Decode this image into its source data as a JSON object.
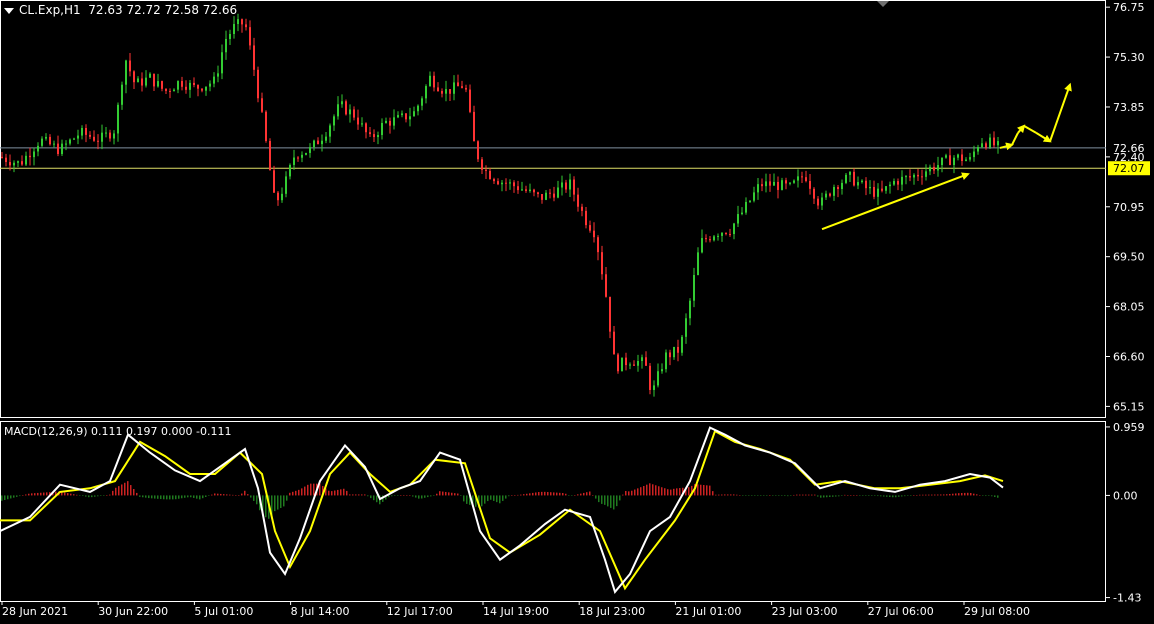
{
  "header": {
    "symbol": "CL.Exp,H1",
    "ohlc": "72.63 72.72 72.58 72.66"
  },
  "macd_header": {
    "label": "MACD(12,26,9) 0.111 0.197 0.000 -0.111"
  },
  "price_axis": {
    "ticks": [
      "76.75",
      "75.30",
      "73.85",
      "72.40",
      "70.95",
      "69.50",
      "68.05",
      "66.60",
      "65.15"
    ],
    "current_price_label": "72.66",
    "level_label": "72.07"
  },
  "macd_axis": {
    "ticks": [
      "0.959",
      "0.00",
      "-1.43"
    ]
  },
  "time_axis": {
    "labels": [
      "28 Jun 2021",
      "30 Jun 22:00",
      "5 Jul 01:00",
      "8 Jul 14:00",
      "12 Jul 17:00",
      "14 Jul 19:00",
      "18 Jul 23:00",
      "21 Jul 01:00",
      "23 Jul 03:00",
      "27 Jul 06:00",
      "29 Jul 08:00"
    ]
  },
  "colors": {
    "background": "#000000",
    "bull": "#33cc33",
    "bear": "#ff3333",
    "macd_line": "#ffffff",
    "signal_line": "#ffff00",
    "hist_pos": "#cc2222",
    "hist_neg": "#1f7a1f",
    "arrow": "#ffff00",
    "current_price_line": "#8090a0",
    "level_line": "#dddd66",
    "level_box": "#ffff00"
  },
  "chart_data": {
    "type": "candlestick",
    "symbol": "CL.Exp",
    "timeframe": "H1",
    "price_range": [
      64.9,
      76.9
    ],
    "close_path": [
      {
        "t": 0,
        "p": 72.4
      },
      {
        "t": 20,
        "p": 72.2
      },
      {
        "t": 40,
        "p": 72.9
      },
      {
        "t": 60,
        "p": 72.6
      },
      {
        "t": 80,
        "p": 73.1
      },
      {
        "t": 100,
        "p": 72.9
      },
      {
        "t": 115,
        "p": 73.2
      },
      {
        "t": 125,
        "p": 75.3
      },
      {
        "t": 135,
        "p": 74.5
      },
      {
        "t": 150,
        "p": 74.7
      },
      {
        "t": 165,
        "p": 74.3
      },
      {
        "t": 180,
        "p": 74.6
      },
      {
        "t": 195,
        "p": 74.4
      },
      {
        "t": 215,
        "p": 74.6
      },
      {
        "t": 225,
        "p": 75.8
      },
      {
        "t": 235,
        "p": 76.2
      },
      {
        "t": 245,
        "p": 76.3
      },
      {
        "t": 255,
        "p": 74.8
      },
      {
        "t": 265,
        "p": 73.0
      },
      {
        "t": 275,
        "p": 71.0
      },
      {
        "t": 285,
        "p": 71.6
      },
      {
        "t": 295,
        "p": 72.5
      },
      {
        "t": 310,
        "p": 72.6
      },
      {
        "t": 325,
        "p": 73.1
      },
      {
        "t": 340,
        "p": 73.9
      },
      {
        "t": 355,
        "p": 73.6
      },
      {
        "t": 370,
        "p": 72.9
      },
      {
        "t": 385,
        "p": 73.4
      },
      {
        "t": 400,
        "p": 73.5
      },
      {
        "t": 415,
        "p": 73.7
      },
      {
        "t": 430,
        "p": 74.7
      },
      {
        "t": 445,
        "p": 74.3
      },
      {
        "t": 465,
        "p": 74.5
      },
      {
        "t": 475,
        "p": 72.6
      },
      {
        "t": 485,
        "p": 72.0
      },
      {
        "t": 500,
        "p": 71.7
      },
      {
        "t": 520,
        "p": 71.5
      },
      {
        "t": 540,
        "p": 71.2
      },
      {
        "t": 555,
        "p": 71.4
      },
      {
        "t": 570,
        "p": 71.6
      },
      {
        "t": 585,
        "p": 70.6
      },
      {
        "t": 595,
        "p": 70.2
      },
      {
        "t": 605,
        "p": 68.6
      },
      {
        "t": 615,
        "p": 66.3
      },
      {
        "t": 630,
        "p": 66.5
      },
      {
        "t": 645,
        "p": 66.4
      },
      {
        "t": 652,
        "p": 65.5
      },
      {
        "t": 665,
        "p": 66.6
      },
      {
        "t": 680,
        "p": 66.8
      },
      {
        "t": 690,
        "p": 68.2
      },
      {
        "t": 700,
        "p": 69.9
      },
      {
        "t": 715,
        "p": 70.2
      },
      {
        "t": 730,
        "p": 70.3
      },
      {
        "t": 745,
        "p": 70.9
      },
      {
        "t": 760,
        "p": 71.6
      },
      {
        "t": 775,
        "p": 71.6
      },
      {
        "t": 790,
        "p": 71.5
      },
      {
        "t": 805,
        "p": 71.9
      },
      {
        "t": 820,
        "p": 71.0
      },
      {
        "t": 835,
        "p": 71.6
      },
      {
        "t": 850,
        "p": 71.8
      },
      {
        "t": 865,
        "p": 71.5
      },
      {
        "t": 880,
        "p": 71.3
      },
      {
        "t": 895,
        "p": 71.7
      },
      {
        "t": 910,
        "p": 71.8
      },
      {
        "t": 925,
        "p": 72.0
      },
      {
        "t": 940,
        "p": 72.2
      },
      {
        "t": 955,
        "p": 72.4
      },
      {
        "t": 970,
        "p": 72.3
      },
      {
        "t": 980,
        "p": 72.9
      },
      {
        "t": 990,
        "p": 72.8
      },
      {
        "t": 1000,
        "p": 72.66
      }
    ],
    "current_price": 72.66,
    "horizontal_level": 72.07,
    "trend_arrow": {
      "from": {
        "t": 822,
        "p": 70.3
      },
      "to": {
        "t": 968,
        "p": 71.9
      }
    },
    "projection_path": [
      {
        "t": 1000,
        "p": 72.66
      },
      {
        "t": 1012,
        "p": 72.75
      },
      {
        "t": 1018,
        "p": 73.1
      },
      {
        "t": 1024,
        "p": 73.3
      },
      {
        "t": 1036,
        "p": 73.1
      },
      {
        "t": 1050,
        "p": 72.85
      },
      {
        "t": 1070,
        "p": 74.5
      }
    ],
    "macd": {
      "params": "12,26,9",
      "value_range": [
        -1.45,
        1.0
      ],
      "main_path": [
        {
          "t": 0,
          "p": -0.5
        },
        {
          "t": 30,
          "p": -0.3
        },
        {
          "t": 60,
          "p": 0.15
        },
        {
          "t": 90,
          "p": 0.05
        },
        {
          "t": 110,
          "p": 0.2
        },
        {
          "t": 128,
          "p": 0.85
        },
        {
          "t": 150,
          "p": 0.6
        },
        {
          "t": 175,
          "p": 0.35
        },
        {
          "t": 200,
          "p": 0.2
        },
        {
          "t": 225,
          "p": 0.45
        },
        {
          "t": 245,
          "p": 0.65
        },
        {
          "t": 258,
          "p": 0.1
        },
        {
          "t": 270,
          "p": -0.8
        },
        {
          "t": 285,
          "p": -1.1
        },
        {
          "t": 300,
          "p": -0.6
        },
        {
          "t": 320,
          "p": 0.2
        },
        {
          "t": 345,
          "p": 0.7
        },
        {
          "t": 365,
          "p": 0.4
        },
        {
          "t": 380,
          "p": -0.05
        },
        {
          "t": 400,
          "p": 0.1
        },
        {
          "t": 420,
          "p": 0.2
        },
        {
          "t": 440,
          "p": 0.6
        },
        {
          "t": 460,
          "p": 0.5
        },
        {
          "t": 480,
          "p": -0.5
        },
        {
          "t": 500,
          "p": -0.9
        },
        {
          "t": 520,
          "p": -0.7
        },
        {
          "t": 545,
          "p": -0.4
        },
        {
          "t": 565,
          "p": -0.2
        },
        {
          "t": 590,
          "p": -0.3
        },
        {
          "t": 605,
          "p": -0.9
        },
        {
          "t": 615,
          "p": -1.35
        },
        {
          "t": 630,
          "p": -1.1
        },
        {
          "t": 650,
          "p": -0.5
        },
        {
          "t": 670,
          "p": -0.3
        },
        {
          "t": 690,
          "p": 0.2
        },
        {
          "t": 710,
          "p": 0.95
        },
        {
          "t": 725,
          "p": 0.85
        },
        {
          "t": 745,
          "p": 0.7
        },
        {
          "t": 770,
          "p": 0.6
        },
        {
          "t": 795,
          "p": 0.45
        },
        {
          "t": 820,
          "p": 0.1
        },
        {
          "t": 845,
          "p": 0.2
        },
        {
          "t": 870,
          "p": 0.1
        },
        {
          "t": 895,
          "p": 0.05
        },
        {
          "t": 920,
          "p": 0.15
        },
        {
          "t": 945,
          "p": 0.2
        },
        {
          "t": 970,
          "p": 0.3
        },
        {
          "t": 990,
          "p": 0.25
        },
        {
          "t": 1003,
          "p": 0.11
        }
      ],
      "signal_path": [
        {
          "t": 0,
          "p": -0.35
        },
        {
          "t": 30,
          "p": -0.35
        },
        {
          "t": 60,
          "p": 0.05
        },
        {
          "t": 90,
          "p": 0.1
        },
        {
          "t": 115,
          "p": 0.2
        },
        {
          "t": 140,
          "p": 0.75
        },
        {
          "t": 165,
          "p": 0.55
        },
        {
          "t": 190,
          "p": 0.3
        },
        {
          "t": 215,
          "p": 0.3
        },
        {
          "t": 240,
          "p": 0.6
        },
        {
          "t": 262,
          "p": 0.3
        },
        {
          "t": 275,
          "p": -0.5
        },
        {
          "t": 290,
          "p": -1.0
        },
        {
          "t": 310,
          "p": -0.5
        },
        {
          "t": 330,
          "p": 0.3
        },
        {
          "t": 350,
          "p": 0.6
        },
        {
          "t": 370,
          "p": 0.3
        },
        {
          "t": 390,
          "p": 0.05
        },
        {
          "t": 410,
          "p": 0.15
        },
        {
          "t": 435,
          "p": 0.5
        },
        {
          "t": 465,
          "p": 0.45
        },
        {
          "t": 490,
          "p": -0.6
        },
        {
          "t": 510,
          "p": -0.8
        },
        {
          "t": 540,
          "p": -0.55
        },
        {
          "t": 570,
          "p": -0.2
        },
        {
          "t": 600,
          "p": -0.5
        },
        {
          "t": 625,
          "p": -1.3
        },
        {
          "t": 645,
          "p": -0.9
        },
        {
          "t": 675,
          "p": -0.35
        },
        {
          "t": 695,
          "p": 0.1
        },
        {
          "t": 715,
          "p": 0.9
        },
        {
          "t": 735,
          "p": 0.75
        },
        {
          "t": 760,
          "p": 0.65
        },
        {
          "t": 790,
          "p": 0.5
        },
        {
          "t": 815,
          "p": 0.15
        },
        {
          "t": 840,
          "p": 0.2
        },
        {
          "t": 875,
          "p": 0.1
        },
        {
          "t": 900,
          "p": 0.1
        },
        {
          "t": 930,
          "p": 0.15
        },
        {
          "t": 960,
          "p": 0.2
        },
        {
          "t": 985,
          "p": 0.28
        },
        {
          "t": 1003,
          "p": 0.2
        }
      ]
    }
  }
}
